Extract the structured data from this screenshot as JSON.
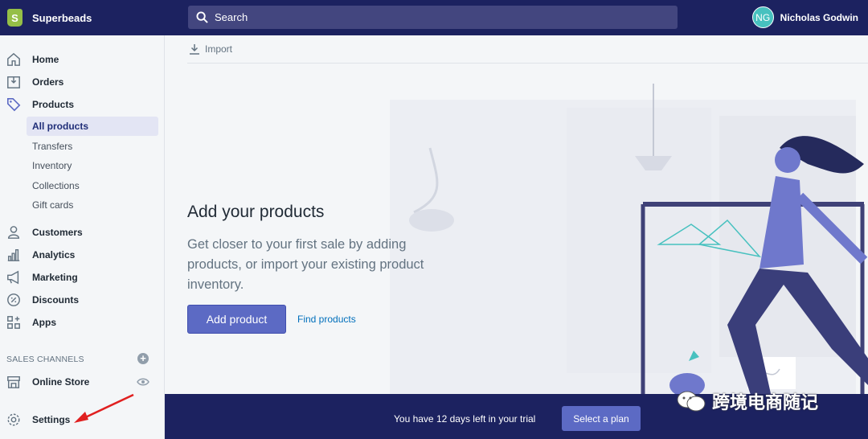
{
  "topbar": {
    "store_name": "Superbeads",
    "logo_letter": "S",
    "search_placeholder": "Search",
    "user_initials": "NG",
    "user_name": "Nicholas Godwin"
  },
  "sidebar": {
    "items": [
      {
        "label": "Home",
        "icon": "home-icon"
      },
      {
        "label": "Orders",
        "icon": "orders-icon"
      },
      {
        "label": "Products",
        "icon": "tag-icon"
      }
    ],
    "products_sub": [
      "All products",
      "Transfers",
      "Inventory",
      "Collections",
      "Gift cards"
    ],
    "items2": [
      {
        "label": "Customers",
        "icon": "person-icon"
      },
      {
        "label": "Analytics",
        "icon": "bar-chart-icon"
      },
      {
        "label": "Marketing",
        "icon": "megaphone-icon"
      },
      {
        "label": "Discounts",
        "icon": "discount-icon"
      },
      {
        "label": "Apps",
        "icon": "apps-icon"
      }
    ],
    "sales_channels_heading": "SALES CHANNELS",
    "online_store": "Online Store",
    "settings": "Settings"
  },
  "main": {
    "import_label": "Import",
    "title": "Add your products",
    "body": "Get closer to your first sale by adding products, or import your existing product inventory.",
    "add_button": "Add product",
    "find_link": "Find products"
  },
  "trial": {
    "message": "You have 12 days left in your trial",
    "button": "Select a plan"
  },
  "watermark": "跨境电商随记",
  "colors": {
    "topbar": "#1c2260",
    "accent": "#5c6ac4",
    "link": "#006fbb",
    "annotation_arrow": "#e02020"
  }
}
